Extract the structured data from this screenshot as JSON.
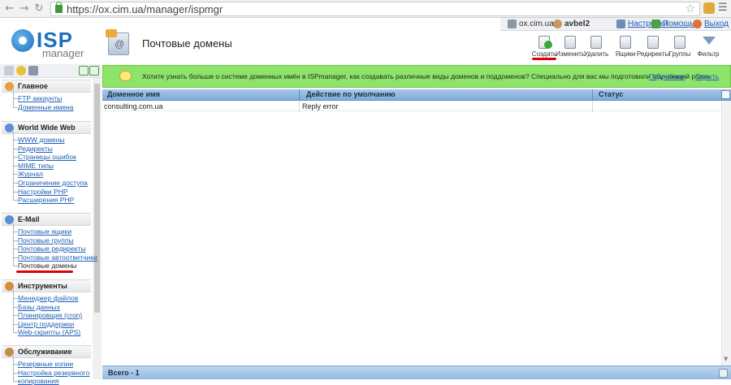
{
  "browser": {
    "url": "https://ox.cim.ua/manager/ispmgr"
  },
  "logo": {
    "brand": "ISP",
    "sub": "manager"
  },
  "header": {
    "title": "Почтовые домены"
  },
  "userbar": {
    "server": "ox.cim.ua ::",
    "user": "avbel2",
    "settings": "Настройки",
    "help": "Помощь",
    "logout": "Выход"
  },
  "toolbar": {
    "create": "Создать",
    "edit": "Изменить",
    "delete": "Удалить",
    "mailboxes": "Ящики",
    "redirects": "Редиректы",
    "groups": "Группы",
    "filter": "Фильтр"
  },
  "sidebar": {
    "groups": [
      {
        "title": "Главное",
        "items": [
          "FTP аккаунты",
          "Доменные имена"
        ]
      },
      {
        "title": "World Wide Web",
        "items": [
          "WWW домены",
          "Редиректы",
          "Страницы ошибок",
          "MIME типы",
          "Журнал",
          "Ограничение доступа",
          "Настройки PHP",
          "Расширения PHP"
        ]
      },
      {
        "title": "E-Mail",
        "items": [
          "Почтовые ящики",
          "Почтовые группы",
          "Почтовые редиректы",
          "Почтовые автоответчики",
          "Почтовые домены"
        ]
      },
      {
        "title": "Инструменты",
        "items": [
          "Менеджер файлов",
          "Базы данных",
          "Планировщик (cron)",
          "Центр поддержки",
          "Web-скрипты (APS)"
        ]
      },
      {
        "title": "Обслуживание",
        "items": [
          "Резервные копии",
          "Настройка резервного",
          "копирования"
        ]
      }
    ]
  },
  "banner": {
    "text": "Хотите узнать больше о системе доменных имён в ISPmanager, как создавать различные виды доменов и поддоменов? Специально для вас мы подготовили обучающий ролик",
    "more": "Подробнее",
    "hide": "Скрыть"
  },
  "table": {
    "columns": [
      "Доменное имя",
      "Действие по умолчанию",
      "Статус"
    ],
    "rows": [
      [
        "consulting.com.ua",
        "Reply error",
        ""
      ]
    ],
    "footer": "Всего - 1"
  },
  "colors": {
    "accent": "#1e6fc0",
    "banner": "#8ee36a",
    "link": "#1f5eb5",
    "annotation": "#e00000",
    "table_header": "#a6c8ea"
  }
}
